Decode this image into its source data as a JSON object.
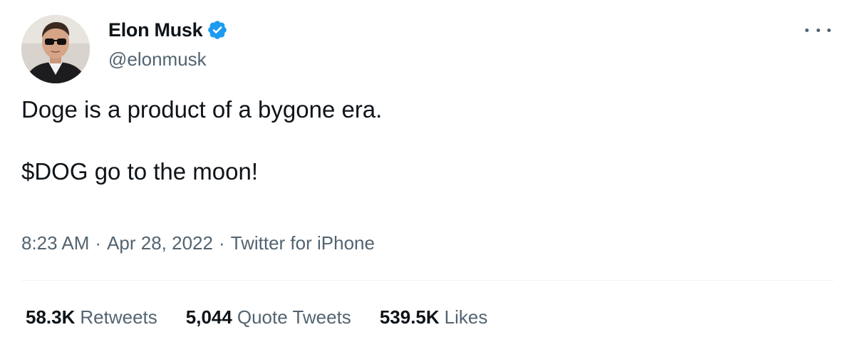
{
  "author": {
    "display_name": "Elon Musk",
    "handle": "@elonmusk",
    "verified": true,
    "avatar_icon": "profile-photo",
    "verified_color": "#1d9bf0"
  },
  "menu": {
    "icon": "more-horizontal-icon"
  },
  "tweet": {
    "line1": "Doge is a product of a bygone era.",
    "line2": "$DOG go to the moon!"
  },
  "meta": {
    "time": "8:23 AM",
    "separator": "·",
    "date": "Apr 28, 2022",
    "source": "Twitter for iPhone"
  },
  "stats": {
    "retweets_count": "58.3K",
    "retweets_label": "Retweets",
    "quotes_count": "5,044",
    "quotes_label": "Quote Tweets",
    "likes_count": "539.5K",
    "likes_label": "Likes"
  },
  "colors": {
    "primary_text": "#0f1419",
    "secondary_text": "#536471",
    "divider": "#eff3f4",
    "background": "#ffffff"
  }
}
